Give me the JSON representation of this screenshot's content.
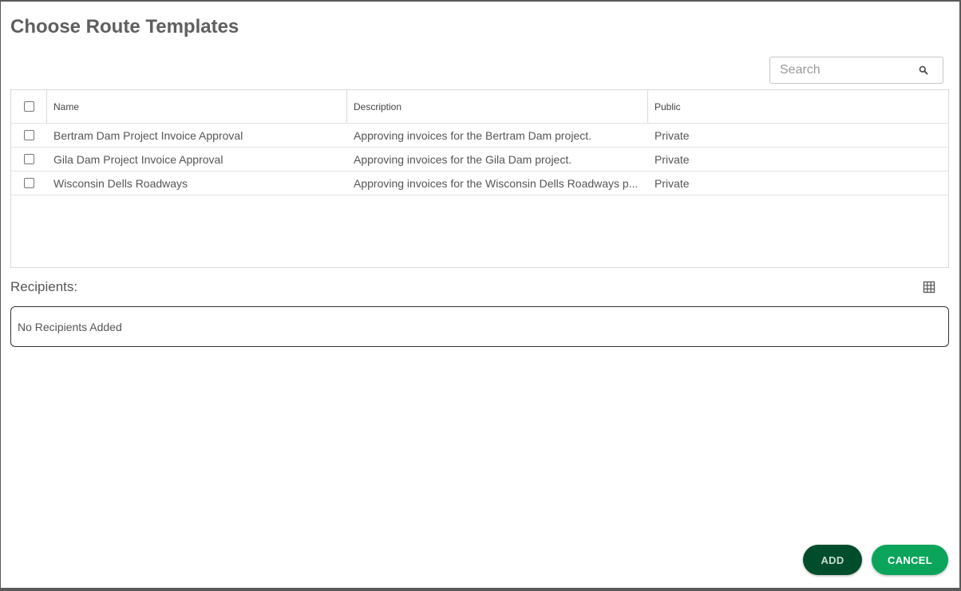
{
  "dialog": {
    "title": "Choose Route Templates"
  },
  "search": {
    "placeholder": "Search",
    "value": "",
    "icon": "search-icon"
  },
  "table": {
    "columns": [
      "Name",
      "Description",
      "Public"
    ],
    "rows": [
      {
        "checked": false,
        "name": "Bertram Dam Project Invoice Approval",
        "description": "Approving invoices for the Bertram Dam project.",
        "public": "Private"
      },
      {
        "checked": false,
        "name": "Gila Dam Project Invoice Approval",
        "description": "Approving invoices for the Gila Dam project.",
        "public": "Private"
      },
      {
        "checked": false,
        "name": "Wisconsin Dells Roadways",
        "description": "Approving invoices for the Wisconsin Dells Roadways p...",
        "public": "Private"
      }
    ]
  },
  "recipients": {
    "label": "Recipients:",
    "empty_text": "No Recipients Added",
    "view_icon": "grid-view-icon"
  },
  "actions": {
    "add_label": "ADD",
    "cancel_label": "CANCEL"
  },
  "colors": {
    "add_button": "#004d2c",
    "cancel_button": "#0aa55b",
    "title_text": "#5f5f5f"
  }
}
